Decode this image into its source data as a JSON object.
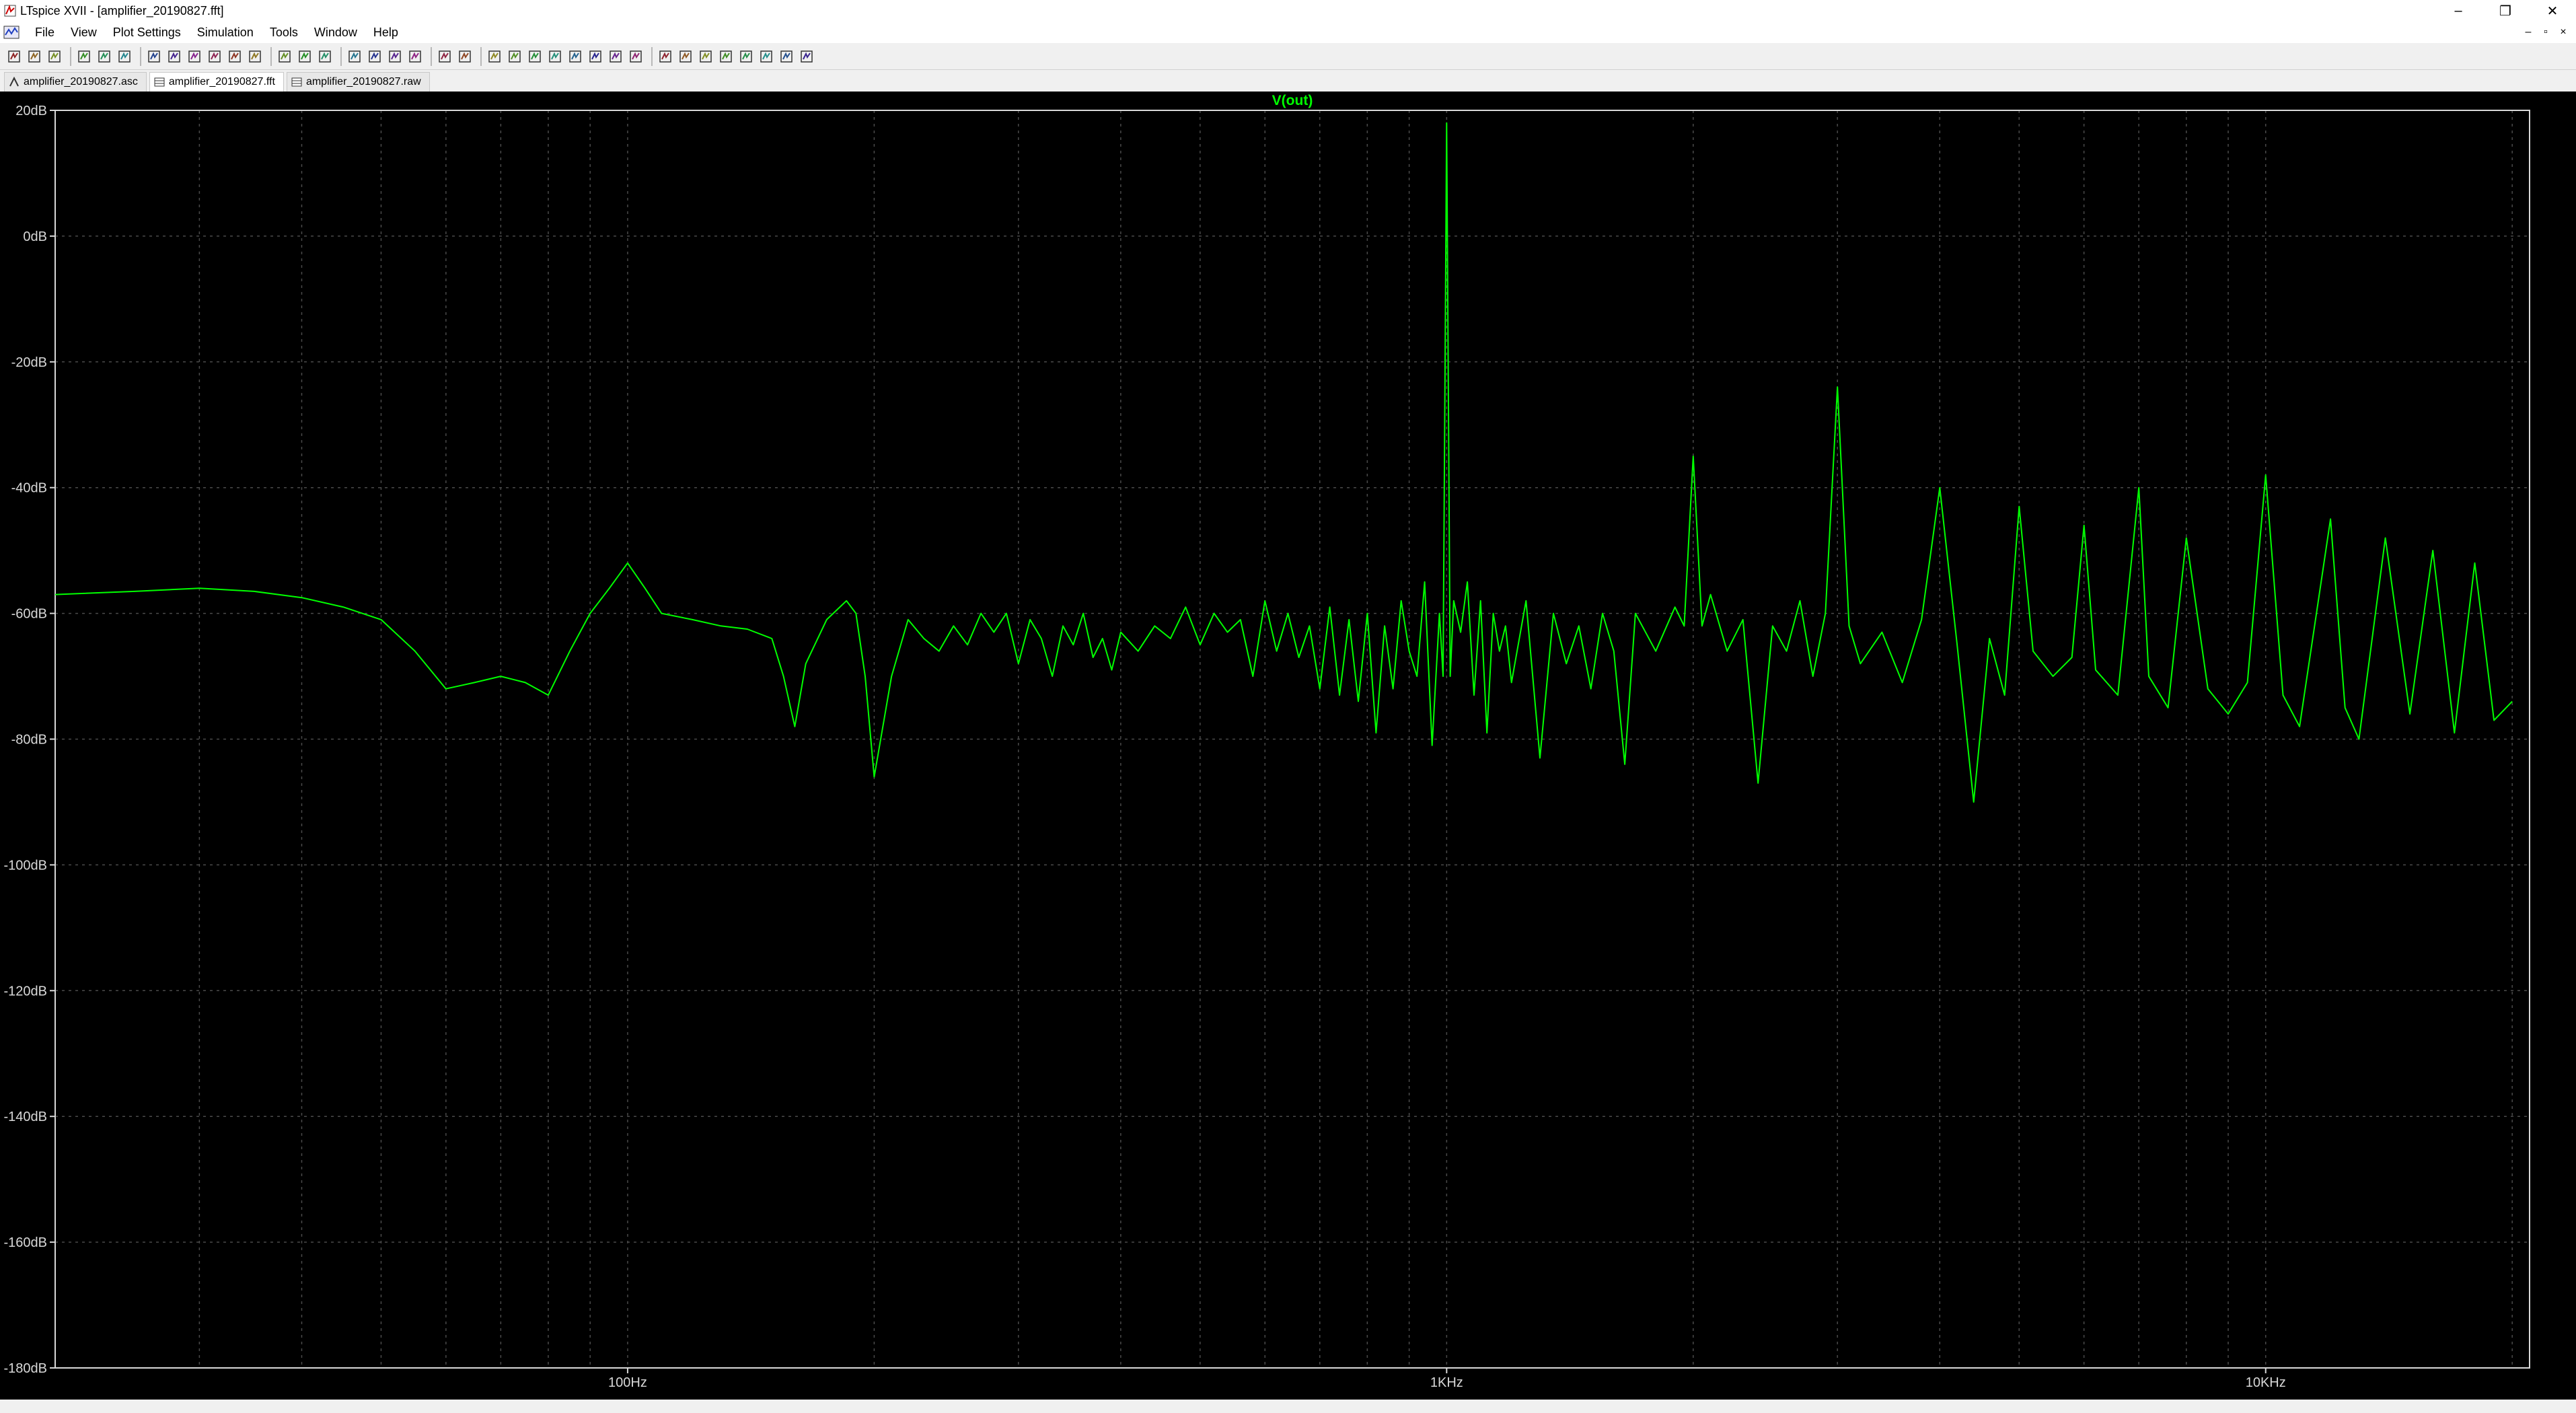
{
  "window": {
    "title": "LTspice XVII - [amplifier_20190827.fft]",
    "controls": {
      "minimize": "–",
      "restore": "❐",
      "close": "✕"
    },
    "mdi_controls": {
      "minimize": "–",
      "restore": "▫",
      "close": "×"
    }
  },
  "menu": [
    {
      "label": "File"
    },
    {
      "label": "View"
    },
    {
      "label": "Plot Settings"
    },
    {
      "label": "Simulation"
    },
    {
      "label": "Tools"
    },
    {
      "label": "Window"
    },
    {
      "label": "Help"
    }
  ],
  "toolbar_icons": [
    "run-icon",
    "open-icon",
    "save-icon",
    "control-panel-icon",
    "halt-icon",
    "pan-icon",
    "zoom-in-icon",
    "zoom-out-icon",
    "zoom-area-icon",
    "zoom-fit-icon",
    "autorange-icon",
    "zoom-extents-icon",
    "tile-horizontal-icon",
    "cascade-icon",
    "tile-vertical-icon",
    "cut-icon",
    "copy-icon",
    "paste-icon",
    "find-icon",
    "print-icon",
    "print-preview-icon",
    "wire-icon",
    "ground-icon",
    "label-icon",
    "resistor-icon",
    "capacitor-icon",
    "inductor-icon",
    "diode-icon",
    "component-icon",
    "move-icon",
    "drag-icon",
    "undo-icon",
    "redo-icon",
    "rotate-icon",
    "mirror-icon",
    "text-icon",
    "spice-directive-icon"
  ],
  "tabs": [
    {
      "label": "amplifier_20190827.asc",
      "active": false
    },
    {
      "label": "amplifier_20190827.fft",
      "active": true
    },
    {
      "label": "amplifier_20190827.raw",
      "active": false
    }
  ],
  "colors": {
    "trace": "#00ff00",
    "trace_label": "#00ff00",
    "grid": "#4a4a4a",
    "axis_text": "#d8d8d8",
    "background": "#000000"
  },
  "chart_data": {
    "type": "line",
    "title": "",
    "series": [
      {
        "name": "V(out)",
        "points": [
          [
            20,
            -57
          ],
          [
            25,
            -56.5
          ],
          [
            30,
            -56
          ],
          [
            35,
            -56.5
          ],
          [
            40,
            -57.5
          ],
          [
            45,
            -59
          ],
          [
            50,
            -61
          ],
          [
            55,
            -66
          ],
          [
            60,
            -72
          ],
          [
            65,
            -71
          ],
          [
            70,
            -70
          ],
          [
            75,
            -71
          ],
          [
            80,
            -73
          ],
          [
            85,
            -66
          ],
          [
            90,
            -60
          ],
          [
            95,
            -56
          ],
          [
            100,
            -52
          ],
          [
            105,
            -56
          ],
          [
            110,
            -60
          ],
          [
            120,
            -61
          ],
          [
            130,
            -62
          ],
          [
            140,
            -62.5
          ],
          [
            150,
            -64
          ],
          [
            155,
            -70
          ],
          [
            160,
            -78
          ],
          [
            165,
            -68
          ],
          [
            175,
            -61
          ],
          [
            185,
            -58
          ],
          [
            190,
            -60
          ],
          [
            195,
            -70
          ],
          [
            200,
            -86
          ],
          [
            210,
            -70
          ],
          [
            220,
            -61
          ],
          [
            230,
            -64
          ],
          [
            240,
            -66
          ],
          [
            250,
            -62
          ],
          [
            260,
            -65
          ],
          [
            270,
            -60
          ],
          [
            280,
            -63
          ],
          [
            290,
            -60
          ],
          [
            300,
            -68
          ],
          [
            310,
            -61
          ],
          [
            320,
            -64
          ],
          [
            330,
            -70
          ],
          [
            340,
            -62
          ],
          [
            350,
            -65
          ],
          [
            360,
            -60
          ],
          [
            370,
            -67
          ],
          [
            380,
            -64
          ],
          [
            390,
            -69
          ],
          [
            400,
            -63
          ],
          [
            420,
            -66
          ],
          [
            440,
            -62
          ],
          [
            460,
            -64
          ],
          [
            480,
            -59
          ],
          [
            500,
            -65
          ],
          [
            520,
            -60
          ],
          [
            540,
            -63
          ],
          [
            560,
            -61
          ],
          [
            580,
            -70
          ],
          [
            600,
            -58
          ],
          [
            620,
            -66
          ],
          [
            640,
            -60
          ],
          [
            660,
            -67
          ],
          [
            680,
            -62
          ],
          [
            700,
            -72
          ],
          [
            720,
            -59
          ],
          [
            740,
            -73
          ],
          [
            760,
            -61
          ],
          [
            780,
            -74
          ],
          [
            800,
            -60
          ],
          [
            820,
            -79
          ],
          [
            840,
            -62
          ],
          [
            860,
            -72
          ],
          [
            880,
            -58
          ],
          [
            900,
            -66
          ],
          [
            920,
            -70
          ],
          [
            940,
            -55
          ],
          [
            960,
            -81
          ],
          [
            980,
            -60
          ],
          [
            990,
            -70
          ],
          [
            1000,
            18
          ],
          [
            1010,
            -70
          ],
          [
            1020,
            -58
          ],
          [
            1040,
            -63
          ],
          [
            1060,
            -55
          ],
          [
            1080,
            -73
          ],
          [
            1100,
            -58
          ],
          [
            1120,
            -79
          ],
          [
            1140,
            -60
          ],
          [
            1160,
            -66
          ],
          [
            1180,
            -62
          ],
          [
            1200,
            -71
          ],
          [
            1250,
            -58
          ],
          [
            1300,
            -83
          ],
          [
            1350,
            -60
          ],
          [
            1400,
            -68
          ],
          [
            1450,
            -62
          ],
          [
            1500,
            -72
          ],
          [
            1550,
            -60
          ],
          [
            1600,
            -66
          ],
          [
            1650,
            -84
          ],
          [
            1700,
            -60
          ],
          [
            1800,
            -66
          ],
          [
            1900,
            -59
          ],
          [
            1950,
            -62
          ],
          [
            2000,
            -35
          ],
          [
            2050,
            -62
          ],
          [
            2100,
            -57
          ],
          [
            2200,
            -66
          ],
          [
            2300,
            -61
          ],
          [
            2400,
            -87
          ],
          [
            2500,
            -62
          ],
          [
            2600,
            -66
          ],
          [
            2700,
            -58
          ],
          [
            2800,
            -70
          ],
          [
            2900,
            -60
          ],
          [
            3000,
            -24
          ],
          [
            3100,
            -62
          ],
          [
            3200,
            -68
          ],
          [
            3400,
            -63
          ],
          [
            3600,
            -71
          ],
          [
            3800,
            -61
          ],
          [
            4000,
            -40
          ],
          [
            4200,
            -65
          ],
          [
            4400,
            -90
          ],
          [
            4600,
            -64
          ],
          [
            4800,
            -73
          ],
          [
            5000,
            -43
          ],
          [
            5200,
            -66
          ],
          [
            5500,
            -70
          ],
          [
            5800,
            -67
          ],
          [
            6000,
            -46
          ],
          [
            6200,
            -69
          ],
          [
            6600,
            -73
          ],
          [
            7000,
            -40
          ],
          [
            7200,
            -70
          ],
          [
            7600,
            -75
          ],
          [
            8000,
            -48
          ],
          [
            8500,
            -72
          ],
          [
            9000,
            -76
          ],
          [
            9500,
            -71
          ],
          [
            10000,
            -38
          ],
          [
            10500,
            -73
          ],
          [
            11000,
            -78
          ],
          [
            12000,
            -45
          ],
          [
            12500,
            -75
          ],
          [
            13000,
            -80
          ],
          [
            14000,
            -48
          ],
          [
            15000,
            -76
          ],
          [
            16000,
            -50
          ],
          [
            17000,
            -79
          ],
          [
            18000,
            -52
          ],
          [
            19000,
            -77
          ],
          [
            20000,
            -74
          ]
        ]
      }
    ],
    "xscale": "log",
    "xlim": [
      20,
      21000
    ],
    "xticks": [
      {
        "value": 100,
        "label": "100Hz"
      },
      {
        "value": 1000,
        "label": "1KHz"
      },
      {
        "value": 10000,
        "label": "10KHz"
      }
    ],
    "ylim": [
      -180,
      20
    ],
    "yticks": [
      {
        "value": 20,
        "label": "20dB"
      },
      {
        "value": 0,
        "label": "0dB"
      },
      {
        "value": -20,
        "label": "-20dB"
      },
      {
        "value": -40,
        "label": "-40dB"
      },
      {
        "value": -60,
        "label": "-60dB"
      },
      {
        "value": -80,
        "label": "-80dB"
      },
      {
        "value": -100,
        "label": "-100dB"
      },
      {
        "value": -120,
        "label": "-120dB"
      },
      {
        "value": -140,
        "label": "-140dB"
      },
      {
        "value": -160,
        "label": "-160dB"
      },
      {
        "value": -180,
        "label": "-180dB"
      }
    ],
    "grid": true,
    "xlabel": "",
    "ylabel": ""
  }
}
